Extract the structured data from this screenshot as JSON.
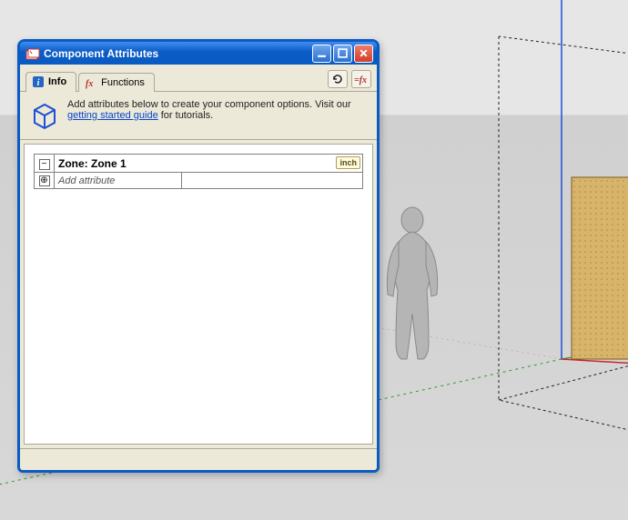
{
  "window": {
    "title": "Component Attributes"
  },
  "tabs": {
    "info": "Info",
    "functions": "Functions"
  },
  "instruction": {
    "text_before": "Add attributes below to create your component options. Visit our ",
    "link_text": "getting started guide",
    "text_after": " for tutorials."
  },
  "attributes": {
    "header_label": "Zone: Zone 1",
    "unit": "inch",
    "add_label": "Add attribute",
    "expand_symbol": "−",
    "add_symbol": "⊕"
  }
}
